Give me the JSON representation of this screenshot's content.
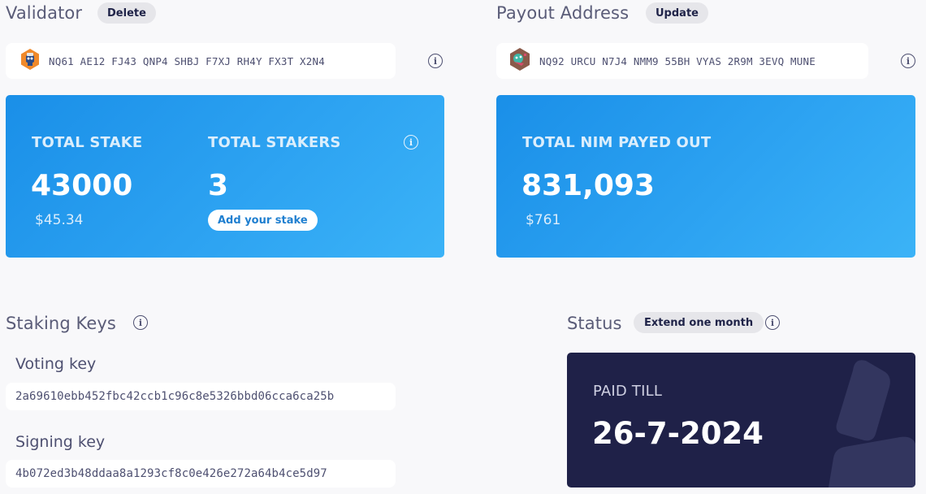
{
  "validator": {
    "title": "Validator",
    "delete_label": "Delete",
    "address": "NQ61 AE12 FJ43 QNP4 SHBJ F7XJ RH4Y FX3T X2N4"
  },
  "payout": {
    "title": "Payout Address",
    "update_label": "Update",
    "address": "NQ92 URCU N7J4 NMM9 55BH VYAS 2R9M 3EVQ MUNE"
  },
  "stake_card": {
    "total_stake_label": "TOTAL STAKE",
    "total_stake_value": "43000",
    "total_stake_usd": "$45.34",
    "total_stakers_label": "TOTAL STAKERS",
    "total_stakers_value": "3",
    "add_stake_label": "Add your stake"
  },
  "payout_card": {
    "label": "TOTAL NIM PAYED OUT",
    "value": "831,093",
    "usd": "$761"
  },
  "staking_keys": {
    "title": "Staking Keys",
    "voting_label": "Voting key",
    "voting_value": "2a69610ebb452fbc42ccb1c96c8e5326bbd06cca6ca25b",
    "signing_label": "Signing key",
    "signing_value": "4b072ed3b48ddaa8a1293cf8c0e426e272a64b4ce5d97"
  },
  "status": {
    "title": "Status",
    "extend_label": "Extend one month",
    "paid_till_label": "PAID TILL",
    "paid_till_value": "26-7-2024"
  },
  "icons": {
    "info": "info-icon",
    "validator_avatar": "identicon-orange",
    "payout_avatar": "identicon-brown"
  },
  "colors": {
    "accent_blue": "#1f9bf0",
    "dark_card": "#1f2148",
    "pill_bg": "#e6e6ea"
  }
}
